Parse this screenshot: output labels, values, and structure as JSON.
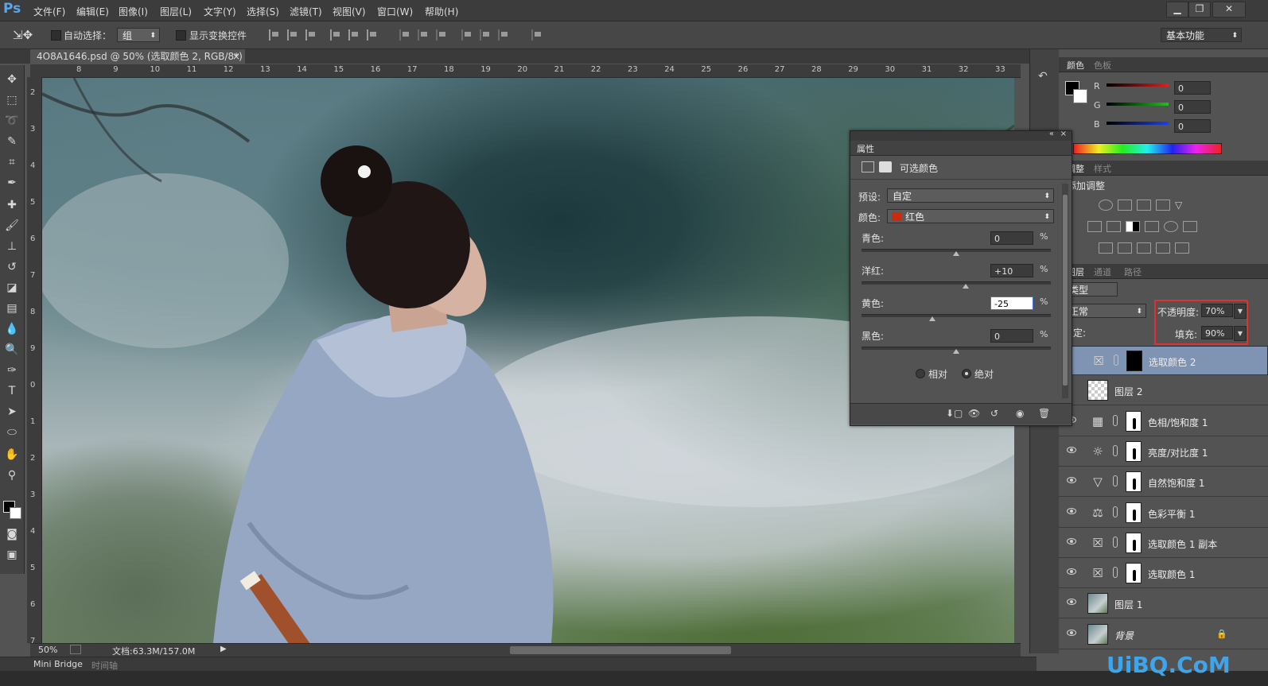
{
  "app": {
    "logo": "Ps"
  },
  "menu": [
    "文件(F)",
    "编辑(E)",
    "图像(I)",
    "图层(L)",
    "文字(Y)",
    "选择(S)",
    "滤镜(T)",
    "视图(V)",
    "窗口(W)",
    "帮助(H)"
  ],
  "window_controls": [
    "▁",
    "❐",
    "✕"
  ],
  "options_bar": {
    "auto_select_label": "自动选择：",
    "auto_select_value": "组",
    "show_transform_label": "显示变换控件",
    "workspace": "基本功能"
  },
  "document_tab": {
    "title": "4O8A1646.psd @ 50% (选取颜色 2, RGB/8*) *",
    "close": "×"
  },
  "rulers": {
    "top": [
      "8",
      "9",
      "10",
      "11",
      "12",
      "13",
      "14",
      "15",
      "16",
      "17",
      "18",
      "19",
      "20",
      "21",
      "22",
      "23",
      "24",
      "25",
      "26",
      "27",
      "28",
      "29",
      "30",
      "31",
      "32",
      "33"
    ],
    "left": [
      "2",
      "3",
      "4",
      "5",
      "6",
      "7",
      "8",
      "9",
      "0",
      "1",
      "2",
      "3",
      "4",
      "5",
      "6",
      "7"
    ]
  },
  "status": {
    "zoom": "50%",
    "doc_info": "文档:63.3M/157.0M"
  },
  "bottom_tabs": [
    "Mini Bridge",
    "时间轴"
  ],
  "color_panel": {
    "tabs": [
      "颜色",
      "色板"
    ],
    "channels": [
      {
        "label": "R",
        "value": "0"
      },
      {
        "label": "G",
        "value": "0"
      },
      {
        "label": "B",
        "value": "0"
      }
    ],
    "colors": {
      "r": "#e02020",
      "g": "#20c020",
      "b": "#2040e0"
    }
  },
  "adjust_panel": {
    "tabs": [
      "调整",
      "样式"
    ],
    "title": "添加调整"
  },
  "layers_panel": {
    "tabs": [
      "图层",
      "通道",
      "路径"
    ],
    "filter": "类型",
    "blend_mode": "正常",
    "opacity_label": "不透明度:",
    "opacity_value": "70%",
    "lock_label": "锁定:",
    "fill_label": "填充:",
    "fill_value": "90%",
    "layers": [
      {
        "name": "选取颜色 2",
        "type": "selective",
        "selected": true,
        "visible": false
      },
      {
        "name": "图层 2",
        "type": "pixel-trans",
        "selected": false,
        "visible": false
      },
      {
        "name": "色相/饱和度 1",
        "type": "huesat",
        "selected": false,
        "visible": true
      },
      {
        "name": "亮度/对比度 1",
        "type": "brightness",
        "selected": false,
        "visible": true
      },
      {
        "name": "自然饱和度 1",
        "type": "vibrance",
        "selected": false,
        "visible": true
      },
      {
        "name": "色彩平衡 1",
        "type": "balance",
        "selected": false,
        "visible": true
      },
      {
        "name": "选取颜色 1 副本",
        "type": "selective",
        "selected": false,
        "visible": true
      },
      {
        "name": "选取颜色 1",
        "type": "selective",
        "selected": false,
        "visible": true
      },
      {
        "name": "图层 1",
        "type": "photo",
        "selected": false,
        "visible": true
      },
      {
        "name": "背景",
        "type": "photo",
        "selected": false,
        "visible": true
      }
    ]
  },
  "properties_panel": {
    "title": "属性",
    "adjust_name": "可选颜色",
    "preset_label": "预设:",
    "preset_value": "自定",
    "color_label": "颜色:",
    "color_value": "红色",
    "color_swatch": "#cc2a10",
    "sliders": [
      {
        "label": "青色:",
        "value": "0",
        "fraction": 0.5
      },
      {
        "label": "洋红:",
        "value": "+10",
        "fraction": 0.55
      },
      {
        "label": "黄色:",
        "value": "-25",
        "fraction": 0.375
      },
      {
        "label": "黑色:",
        "value": "0",
        "fraction": 0.5
      }
    ],
    "percent": "%",
    "method_relative": "相对",
    "method_absolute": "绝对"
  },
  "watermark": "UiBQ.CoM"
}
